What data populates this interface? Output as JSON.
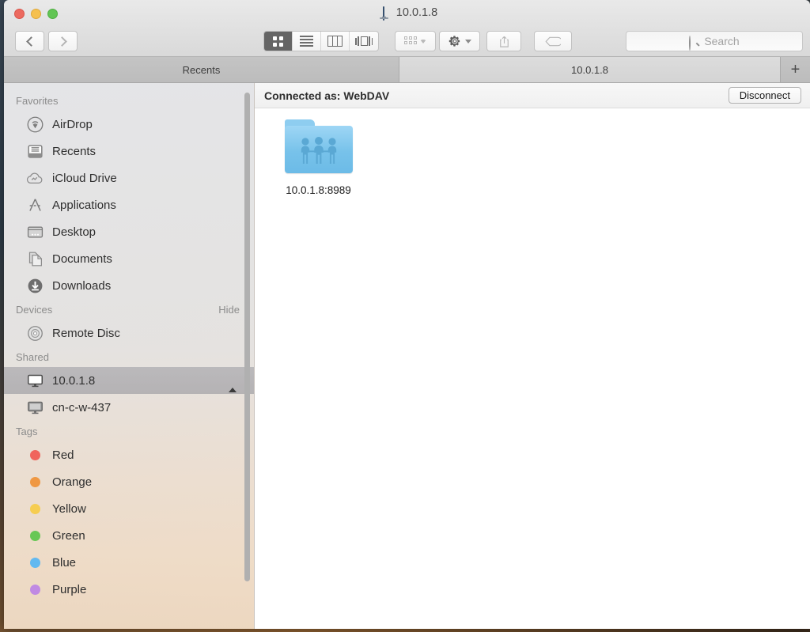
{
  "window": {
    "title": "10.0.1.8",
    "title_icon": "display-icon",
    "traffic_lights": [
      "close-red",
      "minimize-yellow",
      "zoom-green"
    ],
    "colors": {
      "red": "#ec6a5f",
      "yellow": "#f5c04f",
      "green": "#62c554",
      "folder_blue": "#77c2ea",
      "selection_gray": "#a0a0a6"
    }
  },
  "toolbar": {
    "back_label": "",
    "forward_label": "",
    "back_icon": "chevron-left-icon",
    "forward_icon": "chevron-right-icon",
    "view_modes": [
      {
        "name": "icon-view",
        "icon": "grid-icon",
        "active": true
      },
      {
        "name": "list-view",
        "icon": "list-icon",
        "active": false
      },
      {
        "name": "column-view",
        "icon": "columns-icon",
        "active": false
      },
      {
        "name": "gallery-view",
        "icon": "coverflow-icon",
        "active": false
      }
    ],
    "arrange_icon": "arrange-icon",
    "action_icon": "gear-icon",
    "share_icon": "share-icon",
    "tag_icon": "tag-icon",
    "search": {
      "placeholder": "Search",
      "value": "",
      "icon": "search-icon"
    }
  },
  "tabs": {
    "items": [
      {
        "label": "Recents",
        "active": false
      },
      {
        "label": "10.0.1.8",
        "active": true
      }
    ],
    "add_label": "+"
  },
  "sidebar": {
    "sections": [
      {
        "title": "Favorites",
        "action": "",
        "items": [
          {
            "label": "AirDrop",
            "icon": "airdrop-icon"
          },
          {
            "label": "Recents",
            "icon": "recents-icon"
          },
          {
            "label": "iCloud Drive",
            "icon": "icloud-icon"
          },
          {
            "label": "Applications",
            "icon": "applications-icon"
          },
          {
            "label": "Desktop",
            "icon": "desktop-icon"
          },
          {
            "label": "Documents",
            "icon": "documents-icon"
          },
          {
            "label": "Downloads",
            "icon": "downloads-icon"
          }
        ]
      },
      {
        "title": "Devices",
        "action": "Hide",
        "items": [
          {
            "label": "Remote Disc",
            "icon": "optical-disc-icon"
          }
        ]
      },
      {
        "title": "Shared",
        "action": "",
        "items": [
          {
            "label": "10.0.1.8",
            "icon": "display-icon",
            "selected": true,
            "eject": true
          },
          {
            "label": "cn-c-w-437",
            "icon": "computer-icon",
            "selected": false,
            "eject": false
          }
        ]
      },
      {
        "title": "Tags",
        "action": "",
        "items": [
          {
            "label": "Red",
            "icon": "tag-dot-icon",
            "color": "#f0645c"
          },
          {
            "label": "Orange",
            "icon": "tag-dot-icon",
            "color": "#ef9843"
          },
          {
            "label": "Yellow",
            "icon": "tag-dot-icon",
            "color": "#f6cd51"
          },
          {
            "label": "Green",
            "icon": "tag-dot-icon",
            "color": "#68c755"
          },
          {
            "label": "Blue",
            "icon": "tag-dot-icon",
            "color": "#62b9f0"
          },
          {
            "label": "Purple",
            "icon": "tag-dot-icon",
            "color": "#c08ae3"
          }
        ]
      }
    ]
  },
  "content": {
    "connection_status": "Connected as: WebDAV",
    "disconnect_label": "Disconnect",
    "files": [
      {
        "name": "10.0.1.8:8989",
        "icon": "shared-folder-icon"
      }
    ]
  }
}
